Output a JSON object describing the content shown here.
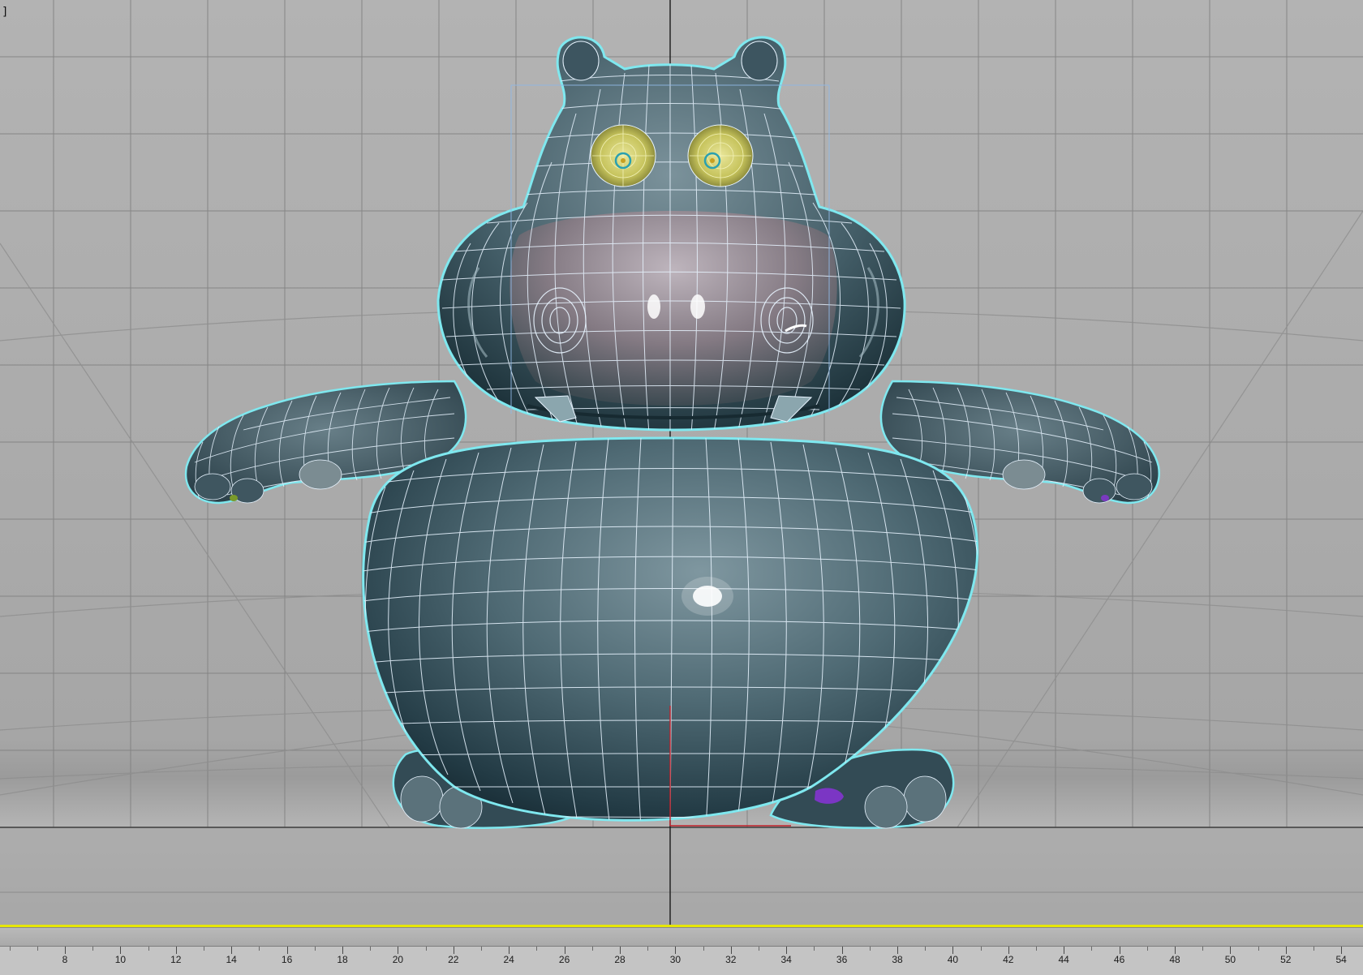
{
  "viewport": {
    "corner_label": "]",
    "model_name": "hippo-character",
    "colors": {
      "background": "#a9a9a9",
      "grid": "#7e7e7e",
      "world_axis": "#1a1a1a",
      "selection_outline": "#7fe8ef",
      "wire": "#e8f4ff",
      "skin_dark": "#1f353e",
      "skin_mid": "#5a7580",
      "snout": "#9e8f97",
      "eye": "#d6d36a",
      "bbox": "#8fb8e6"
    }
  },
  "timeline": {
    "slider_color": "#e6e600",
    "ruler": {
      "labels": [
        "8",
        "10",
        "12",
        "14",
        "16",
        "18",
        "20",
        "22",
        "24",
        "26",
        "28",
        "30",
        "32",
        "34",
        "36",
        "38",
        "40",
        "42",
        "44",
        "46",
        "48",
        "50",
        "52",
        "54"
      ]
    }
  }
}
